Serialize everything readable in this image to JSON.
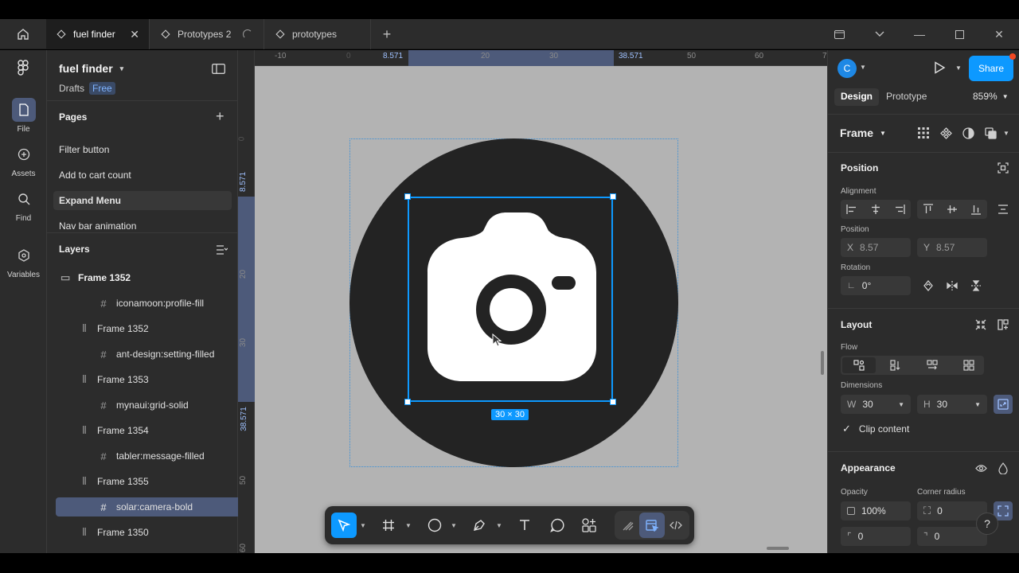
{
  "tabs": [
    {
      "label": "fuel finder",
      "icon": "figma-file-icon",
      "active": true
    },
    {
      "label": "Prototypes 2",
      "icon": "figma-file-icon",
      "active": false
    },
    {
      "label": "prototypes",
      "icon": "figma-file-icon",
      "active": false
    }
  ],
  "rail": [
    {
      "label": "File",
      "icon": "file-icon"
    },
    {
      "label": "Assets",
      "icon": "assets-icon"
    },
    {
      "label": "Find",
      "icon": "search-icon"
    },
    {
      "label": "Variables",
      "icon": "variables-icon"
    }
  ],
  "file": {
    "name": "fuel finder",
    "location": "Drafts",
    "plan_badge": "Free"
  },
  "pages": {
    "heading": "Pages",
    "items": [
      "Filter button",
      "Add to cart count",
      "Expand Menu",
      "Nav bar animation"
    ],
    "selected": "Expand Menu"
  },
  "layers": {
    "heading": "Layers",
    "items": [
      {
        "name": "Frame 1352",
        "type": "frame-bold"
      },
      {
        "name": "iconamoon:profile-fill",
        "type": "frame"
      },
      {
        "name": "Frame 1352",
        "type": "autolayout"
      },
      {
        "name": "ant-design:setting-filled",
        "type": "frame"
      },
      {
        "name": "Frame 1353",
        "type": "autolayout"
      },
      {
        "name": "mynaui:grid-solid",
        "type": "frame"
      },
      {
        "name": "Frame 1354",
        "type": "autolayout"
      },
      {
        "name": "tabler:message-filled",
        "type": "frame"
      },
      {
        "name": "Frame 1355",
        "type": "autolayout"
      },
      {
        "name": "solar:camera-bold",
        "type": "frame"
      },
      {
        "name": "Frame 1350",
        "type": "autolayout"
      }
    ],
    "selected": "solar:camera-bold"
  },
  "rulers": {
    "h": [
      "-10",
      "0",
      "8.571",
      "20",
      "30",
      "38.571",
      "50",
      "60",
      "7"
    ],
    "v": [
      "0",
      "8.571",
      "20",
      "30",
      "38.571",
      "50",
      "60"
    ]
  },
  "canvas": {
    "size_label": "30 × 30"
  },
  "toolbar": {
    "tools": [
      "move-icon",
      "frame-icon",
      "ellipse-icon",
      "pen-icon",
      "text-icon",
      "comment-icon",
      "components-icon",
      "draw-icon",
      "devmode-icon",
      "code-icon"
    ]
  },
  "right": {
    "avatar_letter": "C",
    "share": "Share",
    "tabs": [
      "Design",
      "Prototype"
    ],
    "zoom": "859%",
    "frame_label": "Frame",
    "position_heading": "Position",
    "alignment_label": "Alignment",
    "position_label": "Position",
    "x_label": "X",
    "x_value": "8.57",
    "y_label": "Y",
    "y_value": "8.57",
    "rotation_label": "Rotation",
    "rotation_value": "0°",
    "layout_heading": "Layout",
    "flow_label": "Flow",
    "dimensions_label": "Dimensions",
    "w_label": "W",
    "w_value": "30",
    "h_label": "H",
    "h_value": "30",
    "clip_content": "Clip content",
    "appearance_heading": "Appearance",
    "opacity_label": "Opacity",
    "opacity_value": "100%",
    "corner_label": "Corner radius",
    "corner_value": "0",
    "corner_tl": "0",
    "corner_tr": "0",
    "help": "?"
  },
  "colors": {
    "accent": "#0d99ff",
    "share": "#0d99ff",
    "avatar": "#1e88e5",
    "canvas": "#b3b3b3",
    "icon_bg": "#232323"
  }
}
